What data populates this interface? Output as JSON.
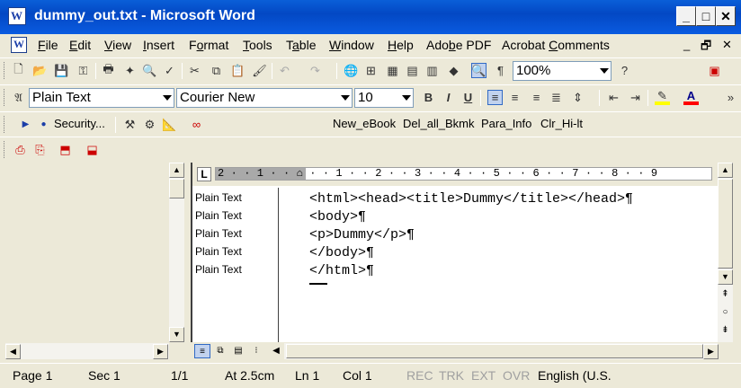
{
  "window": {
    "title": "dummy_out.txt - Microsoft Word",
    "app_icon": "word-icon",
    "minimize": "_",
    "maximize": "□",
    "close": "✕"
  },
  "menu": {
    "items": [
      "File",
      "Edit",
      "View",
      "Insert",
      "Format",
      "Tools",
      "Table",
      "Window",
      "Help",
      "Adobe PDF",
      "Acrobat Comments"
    ],
    "underlined": [
      "F",
      "E",
      "V",
      "I",
      "o",
      "T",
      "a",
      "W",
      "H",
      "b",
      "C"
    ],
    "mdi_min": "_",
    "mdi_restore": "🗗",
    "mdi_close": "✕"
  },
  "standard_toolbar": {
    "zoom": "100%",
    "help_glyph": "?"
  },
  "format_toolbar": {
    "style": "Plain Text",
    "font": "Courier New",
    "size": "10",
    "bold": "B",
    "italic": "I",
    "underline": "U",
    "highlight_color": "#ffff00",
    "font_color": "#ff0000"
  },
  "macro_toolbar": {
    "security": "Security...",
    "macros": [
      "New_eBook",
      "Del_all_Bkmk",
      "Para_Info",
      "Clr_Hi-lt"
    ]
  },
  "ruler": {
    "tab_glyph": "L",
    "numbers": "2 · · 1 · · ⌂ · · 1 · · 2 · · 3 · · 4 · · 5 · · 6 · · 7 · · 8 · · 9"
  },
  "document": {
    "style_labels": [
      "Plain Text",
      "Plain Text",
      "Plain Text",
      "Plain Text",
      "Plain Text"
    ],
    "lines": [
      "<html><head><title>Dummy</title></head>¶",
      "<body>¶",
      "<p>Dummy</p>¶",
      "</body>¶",
      "</html>¶"
    ]
  },
  "status": {
    "page": "Page 1",
    "sec": "Sec 1",
    "pages": "1/1",
    "at": "At 2.5cm",
    "ln": "Ln 1",
    "col": "Col 1",
    "rec": "REC",
    "trk": "TRK",
    "ext": "EXT",
    "ovr": "OVR",
    "language": "English (U.S."
  }
}
